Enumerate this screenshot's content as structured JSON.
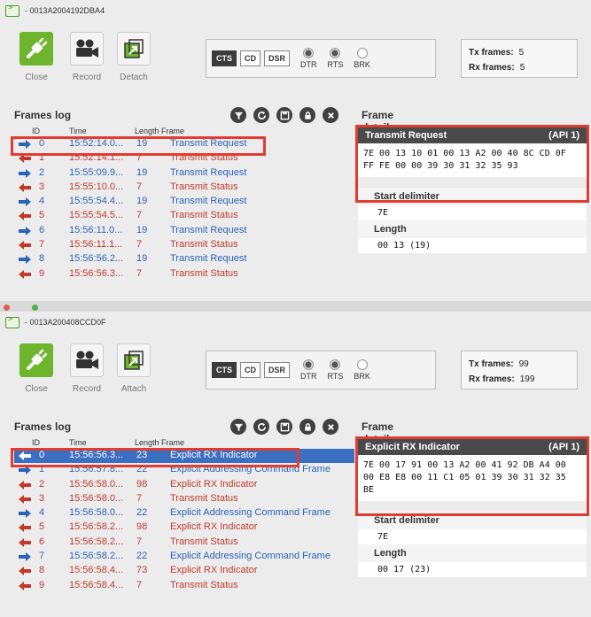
{
  "windows": [
    {
      "device_id": "0013A2004192DBA4",
      "toolbar": {
        "close_label": "Close",
        "record_label": "Record",
        "detach_label": "Detach"
      },
      "signals": {
        "buttons": [
          "CTS",
          "CD",
          "DSR"
        ],
        "cts_on": true,
        "leds": [
          {
            "label": "DTR",
            "on": true
          },
          {
            "label": "RTS",
            "on": true
          },
          {
            "label": "BRK",
            "on": false
          }
        ]
      },
      "counters": {
        "tx_label": "Tx frames:",
        "tx_value": "5",
        "rx_label": "Rx frames:",
        "rx_value": "5"
      },
      "log_title": "Frames log",
      "columns": {
        "id": "ID",
        "time": "Time",
        "length": "Length",
        "frame": "Frame"
      },
      "rows": [
        {
          "id": "0",
          "time": "15:52:14.0...",
          "length": "19",
          "frame": "Transmit Request",
          "dir": "out"
        },
        {
          "id": "1",
          "time": "15:52:14.1...",
          "length": "7",
          "frame": "Transmit Status",
          "dir": "in"
        },
        {
          "id": "2",
          "time": "15:55:09.9...",
          "length": "19",
          "frame": "Transmit Request",
          "dir": "out"
        },
        {
          "id": "3",
          "time": "15:55:10.0...",
          "length": "7",
          "frame": "Transmit Status",
          "dir": "in"
        },
        {
          "id": "4",
          "time": "15:55:54.4...",
          "length": "19",
          "frame": "Transmit Request",
          "dir": "out"
        },
        {
          "id": "5",
          "time": "15:55:54.5...",
          "length": "7",
          "frame": "Transmit Status",
          "dir": "in"
        },
        {
          "id": "6",
          "time": "15:56:11.0...",
          "length": "19",
          "frame": "Transmit Request",
          "dir": "out"
        },
        {
          "id": "7",
          "time": "15:56:11.1...",
          "length": "7",
          "frame": "Transmit Status",
          "dir": "in"
        },
        {
          "id": "8",
          "time": "15:56:56.2...",
          "length": "19",
          "frame": "Transmit Request",
          "dir": "out"
        },
        {
          "id": "9",
          "time": "15:56:56.3...",
          "length": "7",
          "frame": "Transmit Status",
          "dir": "in"
        }
      ],
      "details_title": "Frame details",
      "frame_name": "Transmit Request",
      "frame_api": "(API 1)",
      "frame_hex": "7E 00 13 10 01 00 13 A2 00 40 8C CD 0F FF FE 00 00 39 30 31 32 35 93",
      "fields": [
        {
          "label": "Start delimiter",
          "value": "7E"
        },
        {
          "label": "Length",
          "value": "00 13 (19)"
        }
      ]
    },
    {
      "device_id": "0013A200408CCD0F",
      "toolbar": {
        "close_label": "Close",
        "record_label": "Record",
        "detach_label": "Attach"
      },
      "signals": {
        "buttons": [
          "CTS",
          "CD",
          "DSR"
        ],
        "cts_on": true,
        "leds": [
          {
            "label": "DTR",
            "on": true
          },
          {
            "label": "RTS",
            "on": true
          },
          {
            "label": "BRK",
            "on": false
          }
        ]
      },
      "counters": {
        "tx_label": "Tx frames:",
        "tx_value": "99",
        "rx_label": "Rx frames:",
        "rx_value": "199"
      },
      "log_title": "Frames log",
      "columns": {
        "id": "ID",
        "time": "Time",
        "length": "Length",
        "frame": "Frame"
      },
      "rows": [
        {
          "id": "0",
          "time": "15:56:56.3...",
          "length": "23",
          "frame": "Explicit RX Indicator",
          "dir": "in"
        },
        {
          "id": "1",
          "time": "15:56:57.8...",
          "length": "22",
          "frame": "Explicit Addressing Command Frame",
          "dir": "out"
        },
        {
          "id": "2",
          "time": "15:56:58.0...",
          "length": "98",
          "frame": "Explicit RX Indicator",
          "dir": "in"
        },
        {
          "id": "3",
          "time": "15:56:58.0...",
          "length": "7",
          "frame": "Transmit Status",
          "dir": "in"
        },
        {
          "id": "4",
          "time": "15:56:58.0...",
          "length": "22",
          "frame": "Explicit Addressing Command Frame",
          "dir": "out"
        },
        {
          "id": "5",
          "time": "15:56:58.2...",
          "length": "98",
          "frame": "Explicit RX Indicator",
          "dir": "in"
        },
        {
          "id": "6",
          "time": "15:56:58.2...",
          "length": "7",
          "frame": "Transmit Status",
          "dir": "in"
        },
        {
          "id": "7",
          "time": "15:56:58.2...",
          "length": "22",
          "frame": "Explicit Addressing Command Frame",
          "dir": "out"
        },
        {
          "id": "8",
          "time": "15:56:58.4...",
          "length": "73",
          "frame": "Explicit RX Indicator",
          "dir": "in"
        },
        {
          "id": "9",
          "time": "15:56:58.4...",
          "length": "7",
          "frame": "Transmit Status",
          "dir": "in"
        }
      ],
      "details_title": "Frame details",
      "frame_name": "Explicit RX Indicator",
      "frame_api": "(API 1)",
      "frame_hex": "7E 00 17 91 00 13 A2 00 41 92 DB A4 00 00 E8 E8 00 11 C1 05 01 39 30 31 32 35 BE",
      "fields": [
        {
          "label": "Start delimiter",
          "value": "7E"
        },
        {
          "label": "Length",
          "value": "00 17 (23)"
        }
      ]
    }
  ],
  "colors": {
    "outgoing": "#2a63b8",
    "incoming": "#c0392b",
    "highlight": "#e03c31",
    "close_green": "#6eb52e",
    "selected_row": "#3a6fc2"
  },
  "icons": {
    "device": "console-device-icon",
    "close": "plug-disconnect-icon",
    "record": "video-camera-icon",
    "detach": "window-detach-icon",
    "filter": "funnel-icon",
    "refresh": "refresh-icon",
    "save": "save-disk-icon",
    "lock": "lock-icon",
    "clear": "clear-x-icon",
    "out_arrow": "arrow-right-icon",
    "in_arrow": "arrow-left-icon"
  }
}
